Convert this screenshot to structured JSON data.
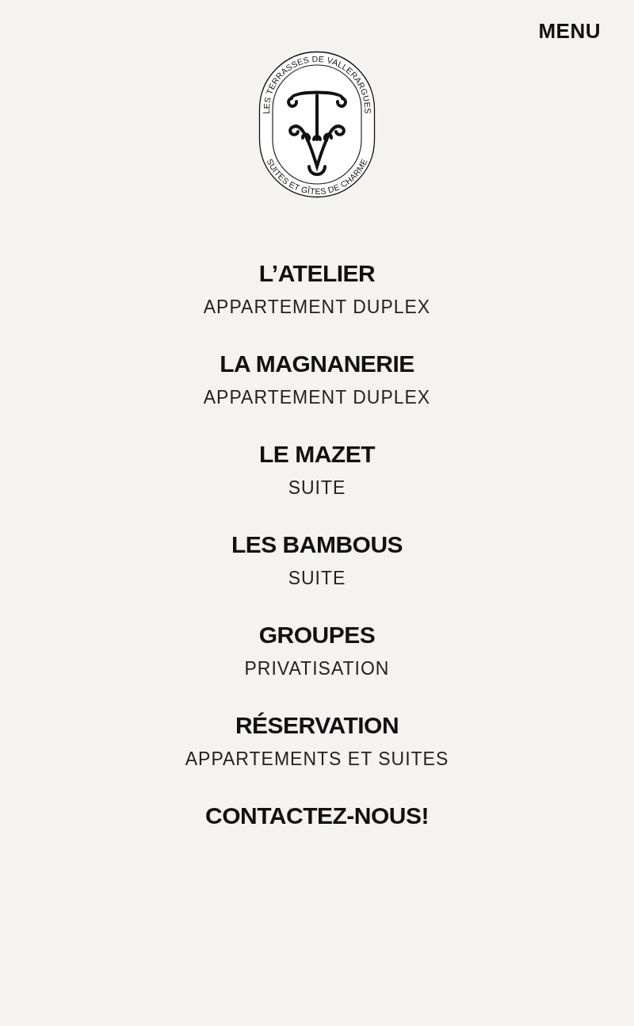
{
  "menu_button": "MENU",
  "logo": {
    "top_text": "LES TERRASSES DE VALLERARGUES",
    "bottom_text": "SUITES ET GÎTES DE CHARME"
  },
  "items": [
    {
      "title": "L’ATELIER",
      "subtitle": "APPARTEMENT DUPLEX"
    },
    {
      "title": "LA MAGNANERIE",
      "subtitle": "APPARTEMENT DUPLEX"
    },
    {
      "title": "LE MAZET",
      "subtitle": "SUITE"
    },
    {
      "title": "LES BAMBOUS",
      "subtitle": "SUITE"
    },
    {
      "title": "GROUPES",
      "subtitle": "PRIVATISATION"
    },
    {
      "title": "RÉSERVATION",
      "subtitle": "APPARTEMENTS ET SUITES"
    },
    {
      "title": "CONTACTEZ-NOUS!"
    }
  ]
}
